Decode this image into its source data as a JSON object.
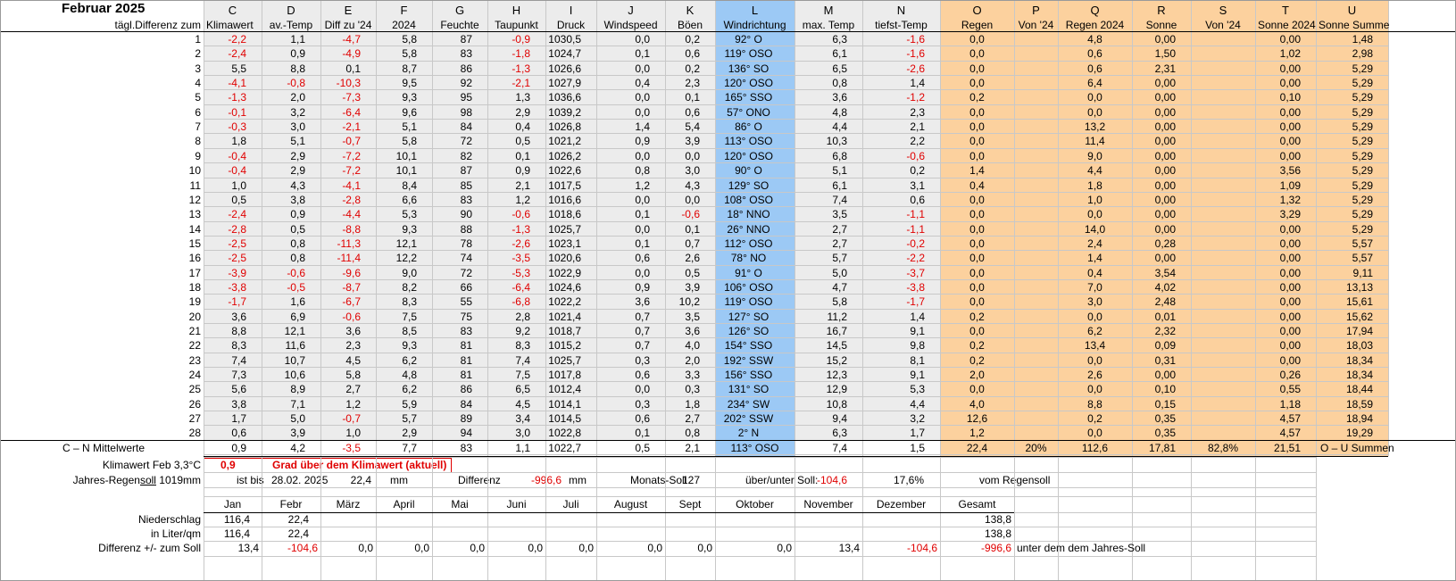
{
  "title": "Februar 2025",
  "header_letters": [
    "C",
    "D",
    "E",
    "F",
    "G",
    "H",
    "I",
    "J",
    "K",
    "L",
    "M",
    "N",
    "O",
    "P",
    "Q",
    "R",
    "S",
    "T",
    "U"
  ],
  "header_row_label": "tägl.Differenz zum",
  "header_labels": [
    "Klimawert",
    "av.-Temp",
    "Diff zu '24",
    "2024",
    "Feuchte",
    "Taupunkt",
    "Druck",
    "Windspeed",
    "Böen",
    "Windrichtung",
    "max. Temp",
    "tiefst-Temp",
    "Regen",
    "Von '24",
    "Regen 2024",
    "Sonne",
    "Von '24",
    "Sonne 2024",
    "Sonne Summe"
  ],
  "rows": [
    [
      "1",
      "-2,2",
      "1,1",
      "-4,7",
      "5,8",
      "87",
      "-0,9",
      "1030,5",
      "0,0",
      "0,2",
      "92° O",
      "6,3",
      "-1,6",
      "0,0",
      "",
      "4,8",
      "0,00",
      "",
      "0,00",
      "1,48"
    ],
    [
      "2",
      "-2,4",
      "0,9",
      "-4,9",
      "5,8",
      "83",
      "-1,8",
      "1024,7",
      "0,1",
      "0,6",
      "119° OSO",
      "6,1",
      "-1,6",
      "0,0",
      "",
      "0,6",
      "1,50",
      "",
      "1,02",
      "2,98"
    ],
    [
      "3",
      "5,5",
      "8,8",
      "0,1",
      "8,7",
      "86",
      "-1,3",
      "1026,6",
      "0,0",
      "0,2",
      "136° SO",
      "6,5",
      "-2,6",
      "0,0",
      "",
      "0,6",
      "2,31",
      "",
      "0,00",
      "5,29"
    ],
    [
      "4",
      "-4,1",
      "-0,8",
      "-10,3",
      "9,5",
      "92",
      "-2,1",
      "1027,9",
      "0,4",
      "2,3",
      "120° OSO",
      "0,8",
      "1,4",
      "0,0",
      "",
      "6,4",
      "0,00",
      "",
      "0,00",
      "5,29"
    ],
    [
      "5",
      "-1,3",
      "2,0",
      "-7,3",
      "9,3",
      "95",
      "1,3",
      "1036,6",
      "0,0",
      "0,1",
      "165° SSO",
      "3,6",
      "-1,2",
      "0,2",
      "",
      "0,0",
      "0,00",
      "",
      "0,10",
      "5,29"
    ],
    [
      "6",
      "-0,1",
      "3,2",
      "-6,4",
      "9,6",
      "98",
      "2,9",
      "1039,2",
      "0,0",
      "0,6",
      "57° ONO",
      "4,8",
      "2,3",
      "0,0",
      "",
      "0,0",
      "0,00",
      "",
      "0,00",
      "5,29"
    ],
    [
      "7",
      "-0,3",
      "3,0",
      "-2,1",
      "5,1",
      "84",
      "0,4",
      "1026,8",
      "1,4",
      "5,4",
      "86° O",
      "4,4",
      "2,1",
      "0,0",
      "",
      "13,2",
      "0,00",
      "",
      "0,00",
      "5,29"
    ],
    [
      "8",
      "1,8",
      "5,1",
      "-0,7",
      "5,8",
      "72",
      "0,5",
      "1021,2",
      "0,9",
      "3,9",
      "113° OSO",
      "10,3",
      "2,2",
      "0,0",
      "",
      "11,4",
      "0,00",
      "",
      "0,00",
      "5,29"
    ],
    [
      "9",
      "-0,4",
      "2,9",
      "-7,2",
      "10,1",
      "82",
      "0,1",
      "1026,2",
      "0,0",
      "0,0",
      "120° OSO",
      "6,8",
      "-0,6",
      "0,0",
      "",
      "9,0",
      "0,00",
      "",
      "0,00",
      "5,29"
    ],
    [
      "10",
      "-0,4",
      "2,9",
      "-7,2",
      "10,1",
      "87",
      "0,9",
      "1022,6",
      "0,8",
      "3,0",
      "90° O",
      "5,1",
      "0,2",
      "1,4",
      "",
      "4,4",
      "0,00",
      "",
      "3,56",
      "5,29"
    ],
    [
      "11",
      "1,0",
      "4,3",
      "-4,1",
      "8,4",
      "85",
      "2,1",
      "1017,5",
      "1,2",
      "4,3",
      "129° SO",
      "6,1",
      "3,1",
      "0,4",
      "",
      "1,8",
      "0,00",
      "",
      "1,09",
      "5,29"
    ],
    [
      "12",
      "0,5",
      "3,8",
      "-2,8",
      "6,6",
      "83",
      "1,2",
      "1016,6",
      "0,0",
      "0,0",
      "108° OSO",
      "7,4",
      "0,6",
      "0,0",
      "",
      "1,0",
      "0,00",
      "",
      "1,32",
      "5,29"
    ],
    [
      "13",
      "-2,4",
      "0,9",
      "-4,4",
      "5,3",
      "90",
      "-0,6",
      "1018,6",
      "0,1",
      "-0,6",
      "18° NNO",
      "3,5",
      "-1,1",
      "0,0",
      "",
      "0,0",
      "0,00",
      "",
      "3,29",
      "5,29"
    ],
    [
      "14",
      "-2,8",
      "0,5",
      "-8,8",
      "9,3",
      "88",
      "-1,3",
      "1025,7",
      "0,0",
      "0,1",
      "26° NNO",
      "2,7",
      "-1,1",
      "0,0",
      "",
      "14,0",
      "0,00",
      "",
      "0,00",
      "5,29"
    ],
    [
      "15",
      "-2,5",
      "0,8",
      "-11,3",
      "12,1",
      "78",
      "-2,6",
      "1023,1",
      "0,1",
      "0,7",
      "112° OSO",
      "2,7",
      "-0,2",
      "0,0",
      "",
      "2,4",
      "0,28",
      "",
      "0,00",
      "5,57"
    ],
    [
      "16",
      "-2,5",
      "0,8",
      "-11,4",
      "12,2",
      "74",
      "-3,5",
      "1020,6",
      "0,6",
      "2,6",
      "78° NO",
      "5,7",
      "-2,2",
      "0,0",
      "",
      "1,4",
      "0,00",
      "",
      "0,00",
      "5,57"
    ],
    [
      "17",
      "-3,9",
      "-0,6",
      "-9,6",
      "9,0",
      "72",
      "-5,3",
      "1022,9",
      "0,0",
      "0,5",
      "91° O",
      "5,0",
      "-3,7",
      "0,0",
      "",
      "0,4",
      "3,54",
      "",
      "0,00",
      "9,11"
    ],
    [
      "18",
      "-3,8",
      "-0,5",
      "-8,7",
      "8,2",
      "66",
      "-6,4",
      "1024,6",
      "0,9",
      "3,9",
      "106° OSO",
      "4,7",
      "-3,8",
      "0,0",
      "",
      "7,0",
      "4,02",
      "",
      "0,00",
      "13,13"
    ],
    [
      "19",
      "-1,7",
      "1,6",
      "-6,7",
      "8,3",
      "55",
      "-6,8",
      "1022,2",
      "3,6",
      "10,2",
      "119° OSO",
      "5,8",
      "-1,7",
      "0,0",
      "",
      "3,0",
      "2,48",
      "",
      "0,00",
      "15,61"
    ],
    [
      "20",
      "3,6",
      "6,9",
      "-0,6",
      "7,5",
      "75",
      "2,8",
      "1021,4",
      "0,7",
      "3,5",
      "127° SO",
      "11,2",
      "1,4",
      "0,2",
      "",
      "0,0",
      "0,01",
      "",
      "0,00",
      "15,62"
    ],
    [
      "21",
      "8,8",
      "12,1",
      "3,6",
      "8,5",
      "83",
      "9,2",
      "1018,7",
      "0,7",
      "3,6",
      "126° SO",
      "16,7",
      "9,1",
      "0,0",
      "",
      "6,2",
      "2,32",
      "",
      "0,00",
      "17,94"
    ],
    [
      "22",
      "8,3",
      "11,6",
      "2,3",
      "9,3",
      "81",
      "8,3",
      "1015,2",
      "0,7",
      "4,0",
      "154° SSO",
      "14,5",
      "9,8",
      "0,2",
      "",
      "13,4",
      "0,09",
      "",
      "0,00",
      "18,03"
    ],
    [
      "23",
      "7,4",
      "10,7",
      "4,5",
      "6,2",
      "81",
      "7,4",
      "1025,7",
      "0,3",
      "2,0",
      "192° SSW",
      "15,2",
      "8,1",
      "0,2",
      "",
      "0,0",
      "0,31",
      "",
      "0,00",
      "18,34"
    ],
    [
      "24",
      "7,3",
      "10,6",
      "5,8",
      "4,8",
      "81",
      "7,5",
      "1017,8",
      "0,6",
      "3,3",
      "156° SSO",
      "12,3",
      "9,1",
      "2,0",
      "",
      "2,6",
      "0,00",
      "",
      "0,26",
      "18,34"
    ],
    [
      "25",
      "5,6",
      "8,9",
      "2,7",
      "6,2",
      "86",
      "6,5",
      "1012,4",
      "0,0",
      "0,3",
      "131° SO",
      "12,9",
      "5,3",
      "0,0",
      "",
      "0,0",
      "0,10",
      "",
      "0,55",
      "18,44"
    ],
    [
      "26",
      "3,8",
      "7,1",
      "1,2",
      "5,9",
      "84",
      "4,5",
      "1014,1",
      "0,3",
      "1,8",
      "234° SW",
      "10,8",
      "4,4",
      "4,0",
      "",
      "8,8",
      "0,15",
      "",
      "1,18",
      "18,59"
    ],
    [
      "27",
      "1,7",
      "5,0",
      "-0,7",
      "5,7",
      "89",
      "3,4",
      "1014,5",
      "0,6",
      "2,7",
      "202° SSW",
      "9,4",
      "3,2",
      "12,6",
      "",
      "0,2",
      "0,35",
      "",
      "4,57",
      "18,94"
    ],
    [
      "28",
      "0,6",
      "3,9",
      "1,0",
      "2,9",
      "94",
      "3,0",
      "1022,8",
      "0,1",
      "0,8",
      "2° N",
      "6,3",
      "1,7",
      "1,2",
      "",
      "0,0",
      "0,35",
      "",
      "4,57",
      "19,29"
    ]
  ],
  "summary": {
    "label": "C – N Mittelwerte",
    "values": [
      "0,9",
      "4,2",
      "-3,5",
      "7,7",
      "83",
      "1,1",
      "1022,7",
      "0,5",
      "2,1",
      "113° OSO",
      "7,4",
      "1,5",
      "22,4",
      "20%",
      "112,6",
      "17,81",
      "82,8%",
      "21,51",
      "O – U Summen"
    ]
  },
  "klima": {
    "label": "Klimawert Feb 3,3°C",
    "value": "0,9",
    "text": "Grad über dem Klimawert (aktuell)"
  },
  "jahres": {
    "label_prefix": "Jahres-Regen",
    "label_underlined": "soll",
    "label_suffix": " 1019mm",
    "ist_bis": "ist bis",
    "date": "28.02. 2025",
    "value": "22,4",
    "unit": "mm",
    "diff_label": "Differenz",
    "diff_value": "-996,6",
    "diff_unit": "mm",
    "monats_label": "Monats-Soll",
    "monats_value": "127",
    "ueber_label": "über/unter Soll:",
    "ueber_value": "-104,6",
    "percent": "17,6%",
    "vom": "vom Regensoll"
  },
  "months": [
    "Jan",
    "Febr",
    "März",
    "April",
    "Mai",
    "Juni",
    "Juli",
    "August",
    "Sept",
    "Oktober",
    "November",
    "Dezember",
    "Gesamt"
  ],
  "niederschlag": {
    "label": "Niederschlag",
    "values": [
      "116,4",
      "22,4",
      "",
      "",
      "",
      "",
      "",
      "",
      "",
      "",
      "",
      "",
      "138,8"
    ]
  },
  "liter": {
    "label": "in Liter/qm",
    "values": [
      "116,4",
      "22,4",
      "",
      "",
      "",
      "",
      "",
      "",
      "",
      "",
      "",
      "",
      "138,8"
    ]
  },
  "differenz": {
    "label": "Differenz  +/- zum Soll",
    "values": [
      "13,4",
      "-104,6",
      "0,0",
      "0,0",
      "0,0",
      "0,0",
      "0,0",
      "0,0",
      "0,0",
      "0,0",
      "13,4",
      "-104,6",
      "-996,6"
    ],
    "note": "unter dem dem Jahres-Soll"
  },
  "colors": {
    "negative": "#e00000",
    "wind_column": "#9cc9f5",
    "rain_sun_columns": "#fcd19e",
    "data_columns": "#ececec"
  }
}
